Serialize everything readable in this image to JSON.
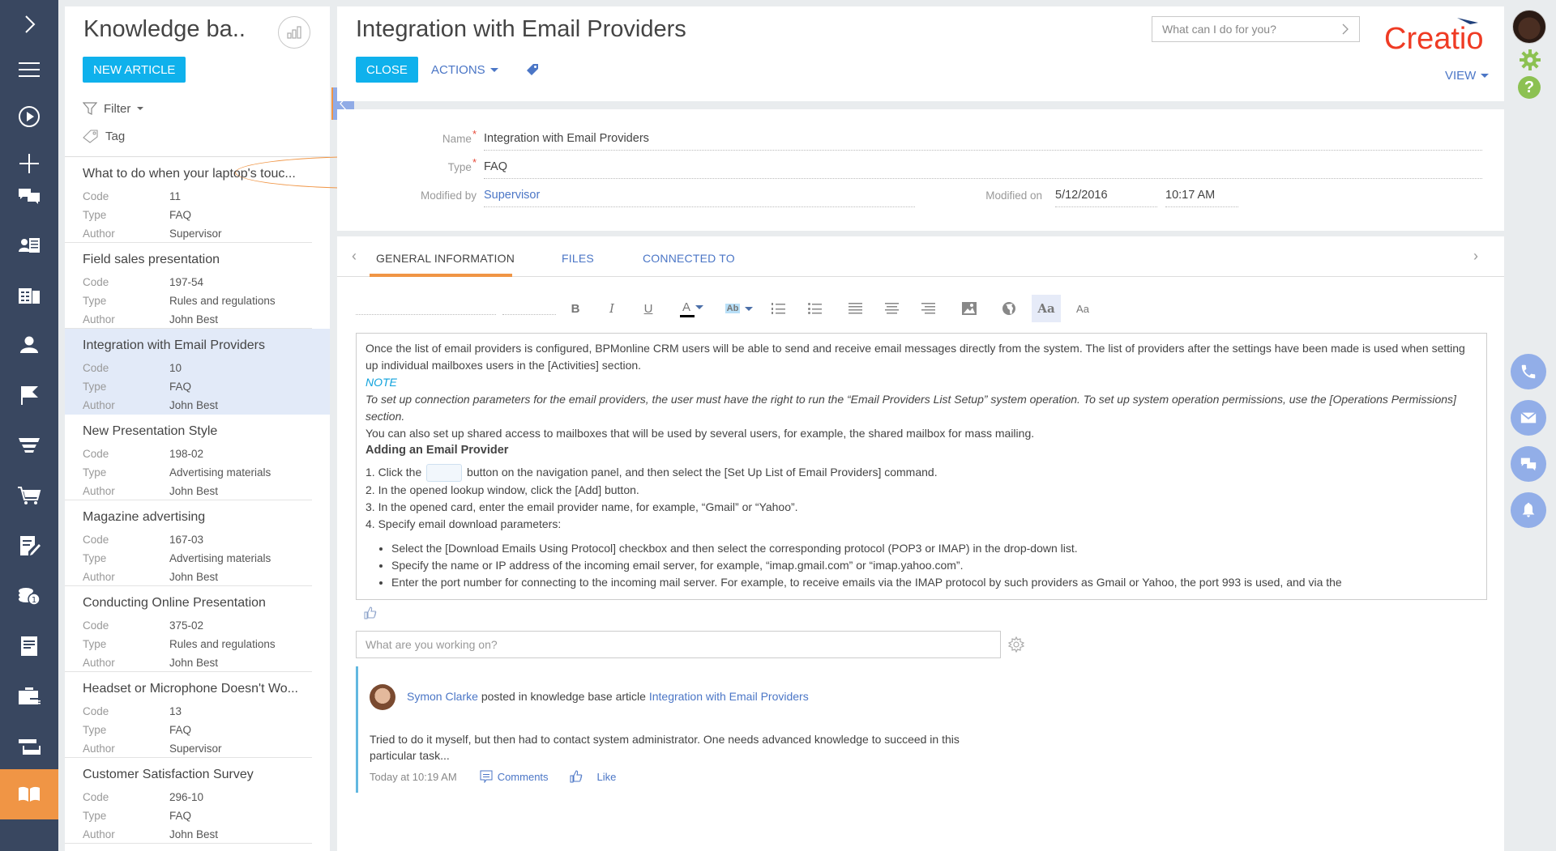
{
  "nav": {
    "items": [
      {
        "name": "expand",
        "icon": "chevron-right-icon"
      },
      {
        "name": "menu",
        "icon": "hamburger-icon"
      },
      {
        "name": "processes",
        "icon": "play-circle-icon"
      },
      {
        "name": "add",
        "icon": "plus-icon"
      },
      {
        "name": "feed",
        "icon": "chat-icon"
      },
      {
        "name": "contacts",
        "icon": "contact-card-icon"
      },
      {
        "name": "accounts",
        "icon": "building-icon"
      },
      {
        "name": "users",
        "icon": "person-icon"
      },
      {
        "name": "activities",
        "icon": "flag-icon"
      },
      {
        "name": "leads",
        "icon": "funnel-icon"
      },
      {
        "name": "orders",
        "icon": "cart-icon"
      },
      {
        "name": "contracts",
        "icon": "document-pen-icon"
      },
      {
        "name": "invoices",
        "icon": "coins-icon"
      },
      {
        "name": "documents",
        "icon": "document-icon"
      },
      {
        "name": "projects",
        "icon": "briefcase-icon"
      },
      {
        "name": "dashboards",
        "icon": "stacked-windows-icon"
      },
      {
        "name": "knowledge-base",
        "icon": "open-book-icon",
        "active": true
      }
    ]
  },
  "section": {
    "title": "Knowledge ba..",
    "new_article": "NEW ARTICLE",
    "filter": "Filter",
    "tag": "Tag",
    "field_labels": {
      "code": "Code",
      "type": "Type",
      "author": "Author"
    },
    "items": [
      {
        "title": "What to do when your laptop's touc...",
        "code": "11",
        "type": "FAQ",
        "author": "Supervisor"
      },
      {
        "title": "Field sales presentation",
        "code": "197-54",
        "type": "Rules and regulations",
        "author": "John Best"
      },
      {
        "title": "Integration with Email Providers",
        "code": "10",
        "type": "FAQ",
        "author": "John Best",
        "selected": true
      },
      {
        "title": "New Presentation Style",
        "code": "198-02",
        "type": "Advertising materials",
        "author": "John Best"
      },
      {
        "title": "Magazine advertising",
        "code": "167-03",
        "type": "Advertising materials",
        "author": "John Best"
      },
      {
        "title": "Conducting Online Presentation",
        "code": "375-02",
        "type": "Rules and regulations",
        "author": "John Best"
      },
      {
        "title": "Headset or Microphone Doesn't Wo...",
        "code": "13",
        "type": "FAQ",
        "author": "Supervisor"
      },
      {
        "title": "Customer Satisfaction Survey",
        "code": "296-10",
        "type": "FAQ",
        "author": "John Best"
      }
    ]
  },
  "header": {
    "title": "Integration with Email Providers",
    "close": "CLOSE",
    "actions": "ACTIONS",
    "assistant_placeholder": "What can I do for you?",
    "logo": "Creatio",
    "view": "VIEW"
  },
  "fields": {
    "name_label": "Name",
    "name_value": "Integration with Email Providers",
    "type_label": "Type",
    "type_value": "FAQ",
    "modified_by_label": "Modified by",
    "modified_by_value": "Supervisor",
    "modified_on_label": "Modified on",
    "modified_on_date": "5/12/2016",
    "modified_on_time": "10:17 AM"
  },
  "tabs": [
    {
      "label": "GENERAL INFORMATION",
      "active": true
    },
    {
      "label": "FILES"
    },
    {
      "label": "CONNECTED TO"
    }
  ],
  "toolbar": {
    "bold": "B",
    "italic": "I",
    "underline": "U",
    "font_color": "A",
    "highlight": "Ab",
    "source_view": "Aa",
    "plain_text": "Aa"
  },
  "article": {
    "p1": "Once the list of email providers is configured, BPMonline CRM users will be able to send and receive email messages directly from the system. The list of providers after the settings have been made is used when setting up individual mailboxes users in the [Activities] section.",
    "note_heading": "NOTE",
    "note": "To set up connection parameters for the email providers, the user must have the right to run the “Email Providers List Setup” system operation. To set up system operation permissions, use the [Operations Permissions] section.",
    "p2": "You can also set up shared access to mailboxes that will be used by several users, for example, the shared mailbox for mass mailing.",
    "heading": "Adding an Email Provider",
    "step1_a": "1. Click the",
    "step1_b": "button on the navigation panel, and then select the [Set Up List of Email Providers] command.",
    "step2": "2. In the opened lookup window, click the [Add] button.",
    "step3": "3. In the opened card, enter the email provider name, for example, “Gmail” or “Yahoo”.",
    "step4": "4. Specify email download parameters:",
    "bullets": [
      "Select the [Download Emails Using Protocol] checkbox and then select the corresponding protocol (POP3 or IMAP) in the drop-down list.",
      "Specify the name or IP address of the incoming email server, for example, “imap.gmail.com” or “imap.yahoo.com”.",
      "Enter the port number for connecting to the incoming mail server. For example, to receive emails via the IMAP protocol by such providers as Gmail or Yahoo, the port 993 is used, and via the"
    ]
  },
  "feed": {
    "input_placeholder": "What are you working on?",
    "post": {
      "author": "Symon Clarke",
      "action": "posted in knowledge base article",
      "target": "Integration with Email Providers",
      "body": "Tried to do it myself, but then had to contact system administrator. One needs advanced knowledge to succeed in this particular task...",
      "time": "Today at 10:19 AM",
      "comments": "Comments",
      "like": "Like"
    }
  },
  "colors": {
    "accent_orange": "#f09545",
    "primary_blue": "#0fb1ec",
    "link_blue": "#4b76c6",
    "nav_bg": "#394760",
    "logo_red": "#ef3b24",
    "comm_blue": "#92aee8",
    "green": "#8cc152"
  }
}
